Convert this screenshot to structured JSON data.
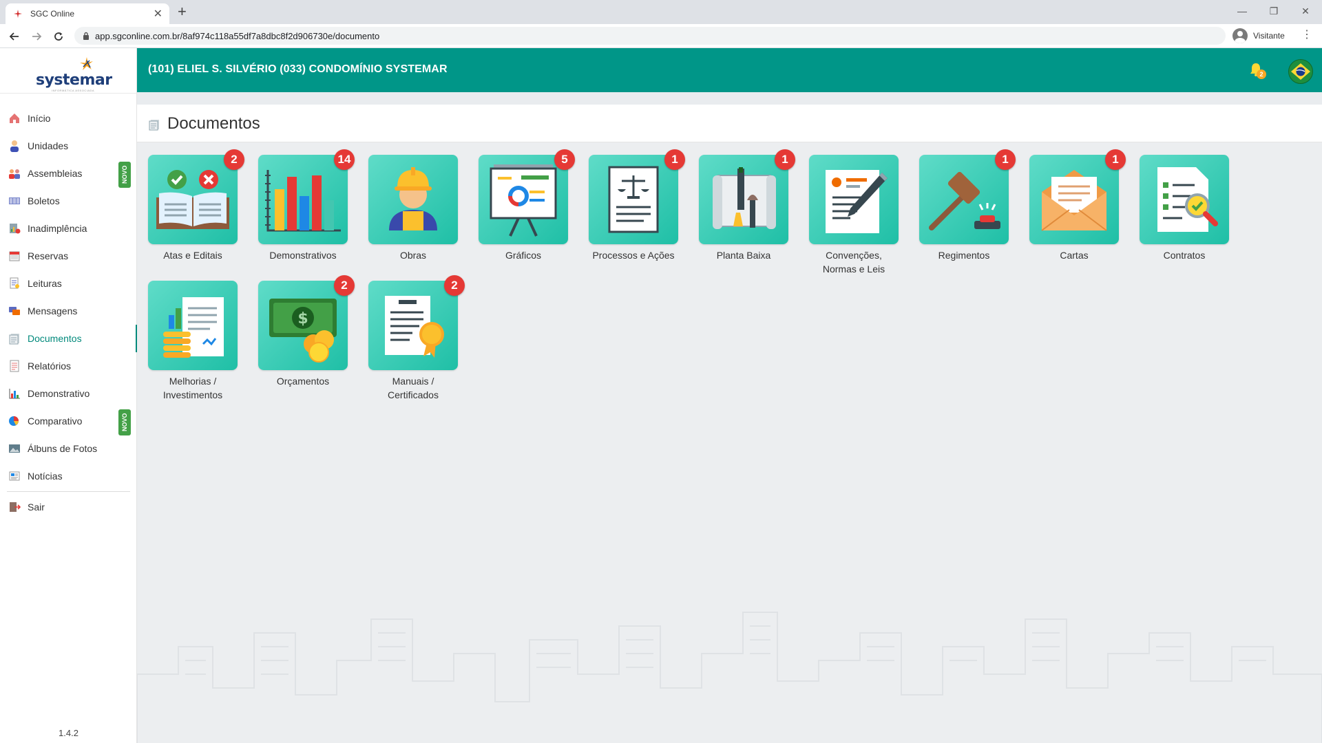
{
  "browser": {
    "tab_title": "SGC Online",
    "url": "app.sgconline.com.br/8af974c118a55df7a8dbc8f2d906730e/documento",
    "profile_name": "Visitante"
  },
  "sidebar": {
    "logo_text": "systemar",
    "logo_tagline": "INFORMÁTICA ASSOCIADA",
    "novo_label": "NOVO",
    "items": [
      {
        "label": "Início",
        "icon": "home-icon"
      },
      {
        "label": "Unidades",
        "icon": "person-icon"
      },
      {
        "label": "Assembleias",
        "icon": "people-icon"
      },
      {
        "label": "Boletos",
        "icon": "barcode-icon"
      },
      {
        "label": "Inadimplência",
        "icon": "debt-chart-icon"
      },
      {
        "label": "Reservas",
        "icon": "calendar-icon"
      },
      {
        "label": "Leituras",
        "icon": "meter-reading-icon"
      },
      {
        "label": "Mensagens",
        "icon": "messages-icon"
      },
      {
        "label": "Documentos",
        "icon": "documents-icon"
      },
      {
        "label": "Relatórios",
        "icon": "report-icon"
      },
      {
        "label": "Demonstrativo",
        "icon": "bar-chart-icon"
      },
      {
        "label": "Comparativo",
        "icon": "pie-chart-icon"
      },
      {
        "label": "Álbuns de Fotos",
        "icon": "photo-album-icon"
      },
      {
        "label": "Notícias",
        "icon": "news-icon"
      }
    ],
    "logout_label": "Sair",
    "version": "1.4.2"
  },
  "header": {
    "user_info": "(101) ELIEL S. SILVÉRIO  (033) CONDOMÍNIO SYSTEMAR",
    "notification_count": "2"
  },
  "page": {
    "title": "Documentos"
  },
  "documents": [
    {
      "label": "Atas e Editais",
      "badge": "2",
      "icon": "book-check-cross-icon"
    },
    {
      "label": "Demonstrativos",
      "badge": "14",
      "icon": "bar-chart-icon"
    },
    {
      "label": "Obras",
      "badge": "",
      "icon": "worker-icon"
    },
    {
      "label": "Gráficos",
      "badge": "5",
      "icon": "presentation-board-icon"
    },
    {
      "label": "Processos e Ações",
      "badge": "1",
      "icon": "legal-scale-icon"
    },
    {
      "label": "Planta Baixa",
      "badge": "1",
      "icon": "blueprint-icon"
    },
    {
      "label": "Convenções, Normas e Leis",
      "badge": "",
      "icon": "contract-pen-icon"
    },
    {
      "label": "Regimentos",
      "badge": "1",
      "icon": "gavel-icon"
    },
    {
      "label": "Cartas",
      "badge": "1",
      "icon": "envelope-icon"
    },
    {
      "label": "Contratos",
      "badge": "",
      "icon": "checklist-magnifier-icon"
    },
    {
      "label": "Melhorias / Investimentos",
      "badge": "",
      "icon": "growth-document-icon"
    },
    {
      "label": "Orçamentos",
      "badge": "2",
      "icon": "money-coins-icon"
    },
    {
      "label": "Manuais / Certificados",
      "badge": "2",
      "icon": "certificate-icon"
    }
  ],
  "colors": {
    "primary": "#009688",
    "badge": "#e53935",
    "tile_gradient_start": "#5fdcc8",
    "tile_gradient_end": "#1fbfa6",
    "novo_badge": "#43a047"
  }
}
